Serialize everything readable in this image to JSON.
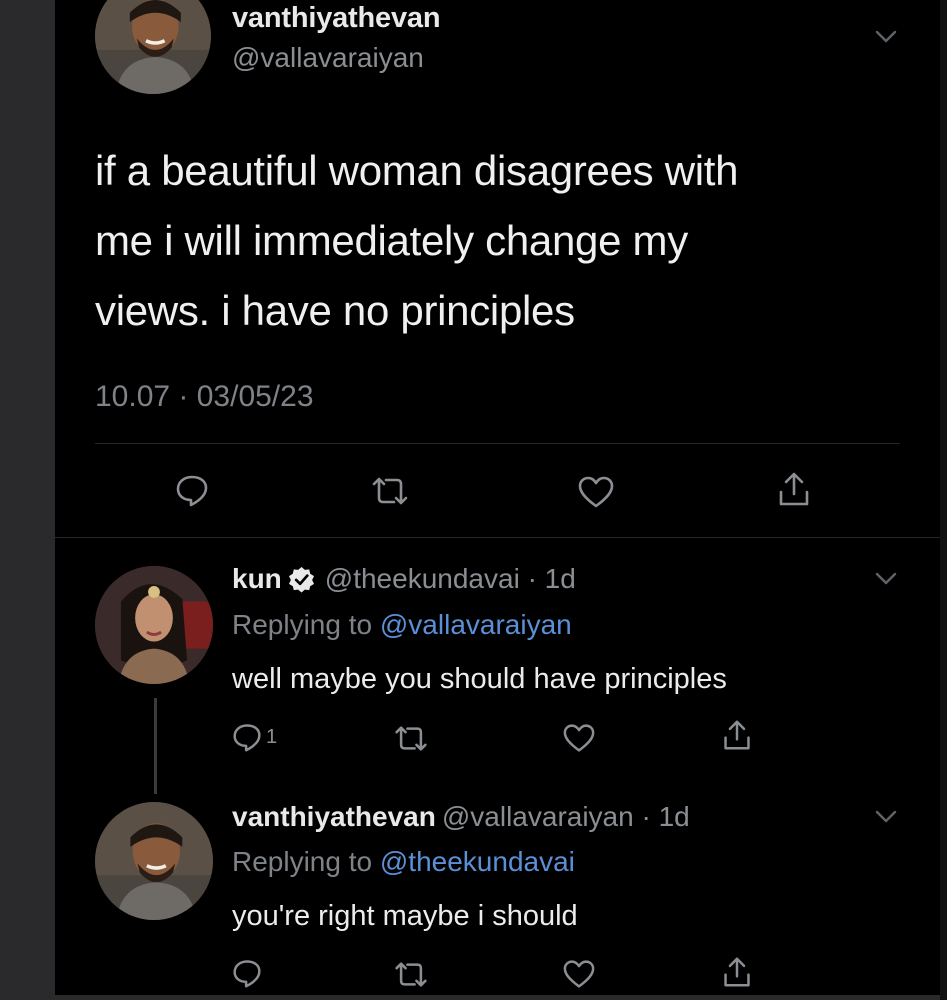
{
  "main_tweet": {
    "display_name": "vanthiyathevan",
    "handle": "@vallavaraiyan",
    "text_lines": [
      "if a beautiful woman disagrees with",
      "me i will immediately change my",
      "views. i have no principles"
    ],
    "timestamp": "10.07 · 03/05/23",
    "avatar_icon": "avatar-man-photo"
  },
  "replies": [
    {
      "display_name": "kun",
      "verified": true,
      "handle_time": "@theekundavai · 1d",
      "replying_prefix": "Replying to ",
      "replying_mention": "@vallavaraiyan",
      "text": "well maybe you should have principles",
      "reply_count": "1",
      "avatar_icon": "avatar-woman-photo"
    },
    {
      "display_name": "vanthiyathevan",
      "verified": false,
      "handle_time": "@vallavaraiyan · 1d",
      "replying_prefix": "Replying to ",
      "replying_mention": "@theekundavai",
      "text": "you're right maybe i should",
      "reply_count": "",
      "avatar_icon": "avatar-man-photo"
    }
  ],
  "icons": {
    "reply": "reply-icon",
    "retweet": "retweet-icon",
    "like": "heart-icon",
    "share": "share-icon",
    "more": "chevron-down-icon",
    "verified": "verified-badge-icon"
  },
  "colors": {
    "background": "#000000",
    "text_primary": "#e9e9e9",
    "text_secondary": "#8b8f93",
    "mention": "#5b8fd6"
  }
}
